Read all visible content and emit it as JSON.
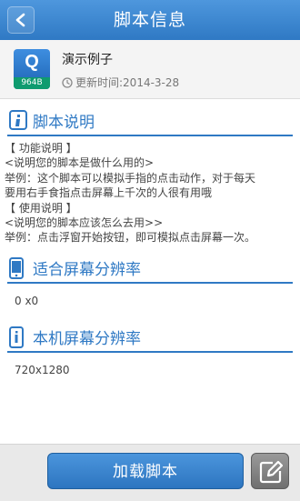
{
  "header": {
    "title": "脚本信息",
    "back_icon": "back-arrow-icon"
  },
  "script": {
    "icon_letter": "Q",
    "icon_size": "964B",
    "name": "演示例子",
    "update_label": "更新时间:",
    "update_date": "2014-3-28"
  },
  "sections": {
    "description": {
      "title": "脚本说明",
      "lines": [
        "【 功能说明 】",
        "<说明您的脚本是做什么用的>",
        "举例：这个脚本可以模拟手指的点击动作，对于每天",
        "要用右手食指点击屏幕上千次的人很有用哦",
        "【 使用说明 】",
        "<说明您的脚本应该怎么去用>>",
        "举例：点击浮窗开始按钮，即可模拟点击屏幕一次。"
      ]
    },
    "fit_resolution": {
      "title": "适合屏幕分辨率",
      "value": "0 x0"
    },
    "device_resolution": {
      "title": "本机屏幕分辨率",
      "value": "720x1280"
    }
  },
  "footer": {
    "load_label": "加载脚本",
    "edit_icon": "edit-icon"
  }
}
